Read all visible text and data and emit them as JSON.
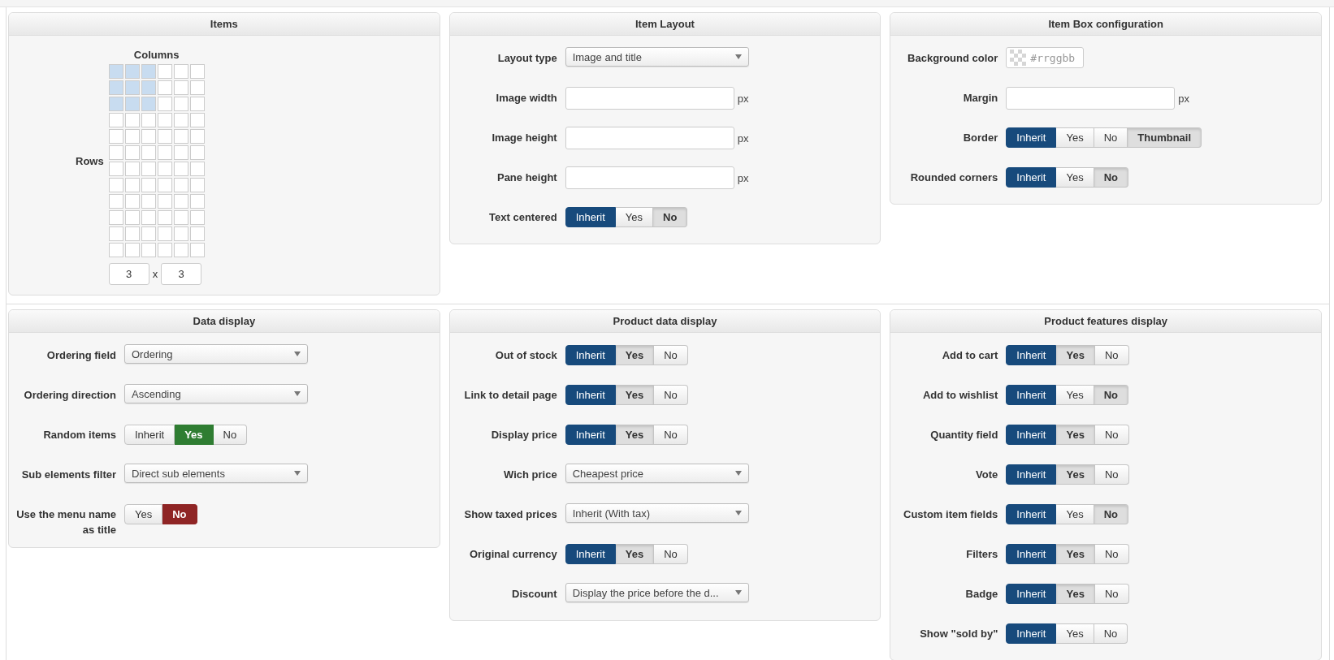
{
  "sections": [
    {
      "panels": [
        {
          "kind": "grid",
          "title": "Items",
          "columns_label": "Columns",
          "rows_label": "Rows",
          "cells": [
            [
              {
                "selected": true
              },
              {
                "selected": true
              },
              {
                "selected": true
              },
              {
                "selected": false
              },
              {
                "selected": false
              },
              {
                "selected": false
              }
            ],
            [
              {
                "selected": true
              },
              {
                "selected": true
              },
              {
                "selected": true
              },
              {
                "selected": false
              },
              {
                "selected": false
              },
              {
                "selected": false
              }
            ],
            [
              {
                "selected": true
              },
              {
                "selected": true
              },
              {
                "selected": true
              },
              {
                "selected": false
              },
              {
                "selected": false
              },
              {
                "selected": false
              }
            ],
            [
              {
                "selected": false
              },
              {
                "selected": false
              },
              {
                "selected": false
              },
              {
                "selected": false
              },
              {
                "selected": false
              },
              {
                "selected": false
              }
            ],
            [
              {
                "selected": false
              },
              {
                "selected": false
              },
              {
                "selected": false
              },
              {
                "selected": false
              },
              {
                "selected": false
              },
              {
                "selected": false
              }
            ],
            [
              {
                "selected": false
              },
              {
                "selected": false
              },
              {
                "selected": false
              },
              {
                "selected": false
              },
              {
                "selected": false
              },
              {
                "selected": false
              }
            ],
            [
              {
                "selected": false
              },
              {
                "selected": false
              },
              {
                "selected": false
              },
              {
                "selected": false
              },
              {
                "selected": false
              },
              {
                "selected": false
              }
            ],
            [
              {
                "selected": false
              },
              {
                "selected": false
              },
              {
                "selected": false
              },
              {
                "selected": false
              },
              {
                "selected": false
              },
              {
                "selected": false
              }
            ],
            [
              {
                "selected": false
              },
              {
                "selected": false
              },
              {
                "selected": false
              },
              {
                "selected": false
              },
              {
                "selected": false
              },
              {
                "selected": false
              }
            ],
            [
              {
                "selected": false
              },
              {
                "selected": false
              },
              {
                "selected": false
              },
              {
                "selected": false
              },
              {
                "selected": false
              },
              {
                "selected": false
              }
            ],
            [
              {
                "selected": false
              },
              {
                "selected": false
              },
              {
                "selected": false
              },
              {
                "selected": false
              },
              {
                "selected": false
              },
              {
                "selected": false
              }
            ],
            [
              {
                "selected": false
              },
              {
                "selected": false
              },
              {
                "selected": false
              },
              {
                "selected": false
              },
              {
                "selected": false
              },
              {
                "selected": false
              }
            ]
          ],
          "columns_value": "3",
          "separator": "x",
          "rows_value": "3"
        },
        {
          "kind": "form",
          "title": "Item Layout",
          "rows": [
            {
              "kind": "select",
              "label": "Layout type",
              "value": "Image and title"
            },
            {
              "kind": "input",
              "label": "Image width",
              "unit": "px"
            },
            {
              "kind": "input",
              "label": "Image height",
              "unit": "px"
            },
            {
              "kind": "input",
              "label": "Pane height",
              "unit": "px"
            },
            {
              "kind": "toggle",
              "label": "Text centered",
              "options": [
                {
                  "label": "Inherit",
                  "selected": true,
                  "color": "#174a7c",
                  "implied": false
                },
                {
                  "label": "Yes",
                  "selected": false,
                  "implied": false
                },
                {
                  "label": "No",
                  "selected": false,
                  "implied": true
                }
              ]
            }
          ]
        },
        {
          "kind": "form",
          "title": "Item Box configuration",
          "rows": [
            {
              "kind": "color",
              "label": "Background color",
              "placeholder": "#rrggbb"
            },
            {
              "kind": "input",
              "label": "Margin",
              "unit": "px"
            },
            {
              "kind": "toggle",
              "label": "Border",
              "options": [
                {
                  "label": "Inherit",
                  "selected": true,
                  "color": "#174a7c",
                  "implied": false
                },
                {
                  "label": "Yes",
                  "selected": false,
                  "implied": false
                },
                {
                  "label": "No",
                  "selected": false,
                  "implied": false
                },
                {
                  "label": "Thumbnail",
                  "selected": false,
                  "implied": true
                }
              ]
            },
            {
              "kind": "toggle",
              "label": "Rounded corners",
              "options": [
                {
                  "label": "Inherit",
                  "selected": true,
                  "color": "#174a7c",
                  "implied": false
                },
                {
                  "label": "Yes",
                  "selected": false,
                  "implied": false
                },
                {
                  "label": "No",
                  "selected": false,
                  "implied": true
                }
              ]
            }
          ]
        }
      ]
    },
    {
      "panels": [
        {
          "kind": "form",
          "title": "Data display",
          "rows": [
            {
              "kind": "select",
              "label": "Ordering field",
              "value": "Ordering"
            },
            {
              "kind": "select",
              "label": "Ordering direction",
              "value": "Ascending"
            },
            {
              "kind": "toggle",
              "label": "Random items",
              "options": [
                {
                  "label": "Inherit",
                  "selected": false,
                  "implied": false
                },
                {
                  "label": "Yes",
                  "selected": true,
                  "color": "#2f7d32",
                  "implied": false
                },
                {
                  "label": "No",
                  "selected": false,
                  "implied": false
                }
              ]
            },
            {
              "kind": "select",
              "label": "Sub elements filter",
              "value": "Direct sub elements"
            },
            {
              "kind": "toggle",
              "label": "Use the menu name as title",
              "options": [
                {
                  "label": "Yes",
                  "selected": false,
                  "implied": false
                },
                {
                  "label": "No",
                  "selected": true,
                  "color": "#8f2525",
                  "implied": false
                }
              ]
            }
          ]
        },
        {
          "kind": "form",
          "title": "Product data display",
          "rows": [
            {
              "kind": "toggle",
              "label": "Out of stock",
              "options": [
                {
                  "label": "Inherit",
                  "selected": true,
                  "color": "#174a7c",
                  "implied": false
                },
                {
                  "label": "Yes",
                  "selected": false,
                  "implied": true
                },
                {
                  "label": "No",
                  "selected": false,
                  "implied": false
                }
              ]
            },
            {
              "kind": "toggle",
              "label": "Link to detail page",
              "options": [
                {
                  "label": "Inherit",
                  "selected": true,
                  "color": "#174a7c",
                  "implied": false
                },
                {
                  "label": "Yes",
                  "selected": false,
                  "implied": true
                },
                {
                  "label": "No",
                  "selected": false,
                  "implied": false
                }
              ]
            },
            {
              "kind": "toggle",
              "label": "Display price",
              "options": [
                {
                  "label": "Inherit",
                  "selected": true,
                  "color": "#174a7c",
                  "implied": false
                },
                {
                  "label": "Yes",
                  "selected": false,
                  "implied": true
                },
                {
                  "label": "No",
                  "selected": false,
                  "implied": false
                }
              ]
            },
            {
              "kind": "select",
              "label": "Wich price",
              "value": "Cheapest price"
            },
            {
              "kind": "select",
              "label": "Show taxed prices",
              "value": "Inherit (With tax)"
            },
            {
              "kind": "toggle",
              "label": "Original currency",
              "options": [
                {
                  "label": "Inherit",
                  "selected": true,
                  "color": "#174a7c",
                  "implied": false
                },
                {
                  "label": "Yes",
                  "selected": false,
                  "implied": true
                },
                {
                  "label": "No",
                  "selected": false,
                  "implied": false
                }
              ]
            },
            {
              "kind": "select",
              "label": "Discount",
              "value": "Display the price before the d..."
            }
          ]
        },
        {
          "kind": "form",
          "title": "Product features display",
          "rows": [
            {
              "kind": "toggle",
              "label": "Add to cart",
              "options": [
                {
                  "label": "Inherit",
                  "selected": true,
                  "color": "#174a7c",
                  "implied": false
                },
                {
                  "label": "Yes",
                  "selected": false,
                  "implied": true
                },
                {
                  "label": "No",
                  "selected": false,
                  "implied": false
                }
              ]
            },
            {
              "kind": "toggle",
              "label": "Add to wishlist",
              "options": [
                {
                  "label": "Inherit",
                  "selected": true,
                  "color": "#174a7c",
                  "implied": false
                },
                {
                  "label": "Yes",
                  "selected": false,
                  "implied": false
                },
                {
                  "label": "No",
                  "selected": false,
                  "implied": true
                }
              ]
            },
            {
              "kind": "toggle",
              "label": "Quantity field",
              "options": [
                {
                  "label": "Inherit",
                  "selected": true,
                  "color": "#174a7c",
                  "implied": false
                },
                {
                  "label": "Yes",
                  "selected": false,
                  "implied": true
                },
                {
                  "label": "No",
                  "selected": false,
                  "implied": false
                }
              ]
            },
            {
              "kind": "toggle",
              "label": "Vote",
              "options": [
                {
                  "label": "Inherit",
                  "selected": true,
                  "color": "#174a7c",
                  "implied": false
                },
                {
                  "label": "Yes",
                  "selected": false,
                  "implied": true
                },
                {
                  "label": "No",
                  "selected": false,
                  "implied": false
                }
              ]
            },
            {
              "kind": "toggle",
              "label": "Custom item fields",
              "options": [
                {
                  "label": "Inherit",
                  "selected": true,
                  "color": "#174a7c",
                  "implied": false
                },
                {
                  "label": "Yes",
                  "selected": false,
                  "implied": false
                },
                {
                  "label": "No",
                  "selected": false,
                  "implied": true
                }
              ]
            },
            {
              "kind": "toggle",
              "label": "Filters",
              "options": [
                {
                  "label": "Inherit",
                  "selected": true,
                  "color": "#174a7c",
                  "implied": false
                },
                {
                  "label": "Yes",
                  "selected": false,
                  "implied": true
                },
                {
                  "label": "No",
                  "selected": false,
                  "implied": false
                }
              ]
            },
            {
              "kind": "toggle",
              "label": "Badge",
              "options": [
                {
                  "label": "Inherit",
                  "selected": true,
                  "color": "#174a7c",
                  "implied": false
                },
                {
                  "label": "Yes",
                  "selected": false,
                  "implied": true
                },
                {
                  "label": "No",
                  "selected": false,
                  "implied": false
                }
              ]
            },
            {
              "kind": "toggle",
              "label": "Show \"sold by\"",
              "options": [
                {
                  "label": "Inherit",
                  "selected": true,
                  "color": "#174a7c",
                  "implied": false
                },
                {
                  "label": "Yes",
                  "selected": false,
                  "implied": false
                },
                {
                  "label": "No",
                  "selected": false,
                  "implied": false
                }
              ]
            }
          ]
        }
      ]
    }
  ]
}
